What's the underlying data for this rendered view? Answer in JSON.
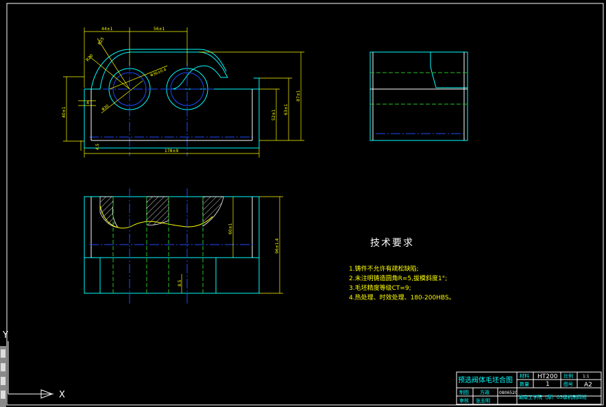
{
  "colors": {
    "background": "#000000",
    "frame": "#ffffff",
    "outline": "#00ffff",
    "dimension": "#ffff00",
    "centerline": "#1e4dff",
    "hidden": "#27c227"
  },
  "dims": {
    "d1": "44±1",
    "d2": "56±1",
    "d3": "R25",
    "d4": "R20",
    "d5": "Φ36±0.4",
    "d6": "Φ30",
    "d7": "40±1",
    "d8": "4",
    "d9": "4.5",
    "d10": "178±9",
    "d11": "52±1",
    "d12": "63±1",
    "d13": "87±1",
    "d14": "60±1",
    "d15": "96±1.4",
    "d16": "8.5"
  },
  "tech": {
    "heading": "技术要求",
    "items": [
      "1.铸件不允许有疏松缺陷;",
      "2.未注明铸造圆角R=5,拔模斜度1°;",
      "3.毛坯精度等级CT=9;",
      "4.热处理、时效处理、180-200HBS。"
    ]
  },
  "title_block": {
    "drawing_name": "预选阀体毛坯合图",
    "material_label": "材料",
    "material": "HT200",
    "scale_label": "比例",
    "scale": "1:1",
    "qty_label": "数量",
    "qty": "1",
    "sheet_label": "图号",
    "sheet": "A2",
    "drawn_label": "制图",
    "drawn_name": "方政",
    "drawn_no": "0806520",
    "check_label": "审核",
    "check_name": "张志明",
    "school": "湖南工学院（厚）05级机制四班"
  },
  "ucs": {
    "y": "Y",
    "x": "X"
  }
}
